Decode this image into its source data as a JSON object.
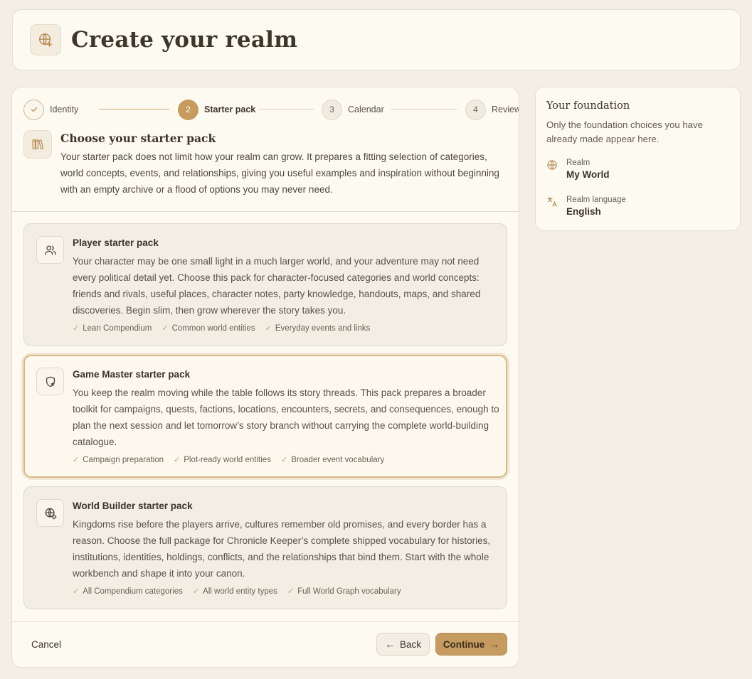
{
  "header": {
    "title": "Create your realm",
    "icon": "globe-plus-icon"
  },
  "stepper": {
    "steps": [
      {
        "number": "",
        "label": "Identity",
        "state": "done"
      },
      {
        "number": "2",
        "label": "Starter pack",
        "state": "active"
      },
      {
        "number": "3",
        "label": "Calendar",
        "state": "upcoming"
      },
      {
        "number": "4",
        "label": "Review",
        "state": "upcoming"
      }
    ]
  },
  "intro": {
    "icon": "books-icon",
    "title": "Choose your starter pack",
    "text": "Your starter pack does not limit how your realm can grow. It prepares a fitting selection of categories, world concepts, events, and relationships, giving you useful examples and inspiration without beginning with an empty archive or a flood of options you may never need."
  },
  "packs": [
    {
      "icon": "users-icon",
      "title": "Player starter pack",
      "description": "Your character may be one small light in a much larger world, and your adventure may not need every political detail yet. Choose this pack for character-focused categories and world concepts: friends and rivals, useful places, character notes, party knowledge, handouts, maps, and shared discoveries. Begin slim, then grow wherever the story takes you.",
      "tags": [
        "Lean Compendium",
        "Common world entities",
        "Everyday events and links"
      ],
      "selected": false
    },
    {
      "icon": "shield-star-icon",
      "title": "Game Master starter pack",
      "description": "You keep the realm moving while the table follows its story threads. This pack prepares a broader toolkit for campaigns, quests, factions, locations, encounters, secrets, and consequences, enough to plan the next session and let tomorrow’s story branch without carrying the complete world-building catalogue.",
      "tags": [
        "Campaign preparation",
        "Plot-ready world entities",
        "Broader event vocabulary"
      ],
      "selected": true
    },
    {
      "icon": "globe-gear-icon",
      "title": "World Builder starter pack",
      "description": "Kingdoms rise before the players arrive, cultures remember old promises, and every border has a reason. Choose the full package for Chronicle Keeper’s complete shipped vocabulary for histories, institutions, identities, holdings, conflicts, and the relationships that bind them. Start with the whole workbench and shape it into your canon.",
      "tags": [
        "All Compendium categories",
        "All world entity types",
        "Full World Graph vocabulary"
      ],
      "selected": false
    }
  ],
  "footer": {
    "cancel_label": "Cancel",
    "back_label": "Back",
    "continue_label": "Continue"
  },
  "sidebar": {
    "title": "Your foundation",
    "subtitle": "Only the foundation choices you have already made appear here.",
    "realm_label": "Realm",
    "realm_value": "My World",
    "language_label": "Realm language",
    "language_value": "English"
  },
  "colors": {
    "accent": "#c69b62",
    "background": "#f4efe5",
    "card": "#fdfaf2",
    "check": "#c2a574"
  }
}
